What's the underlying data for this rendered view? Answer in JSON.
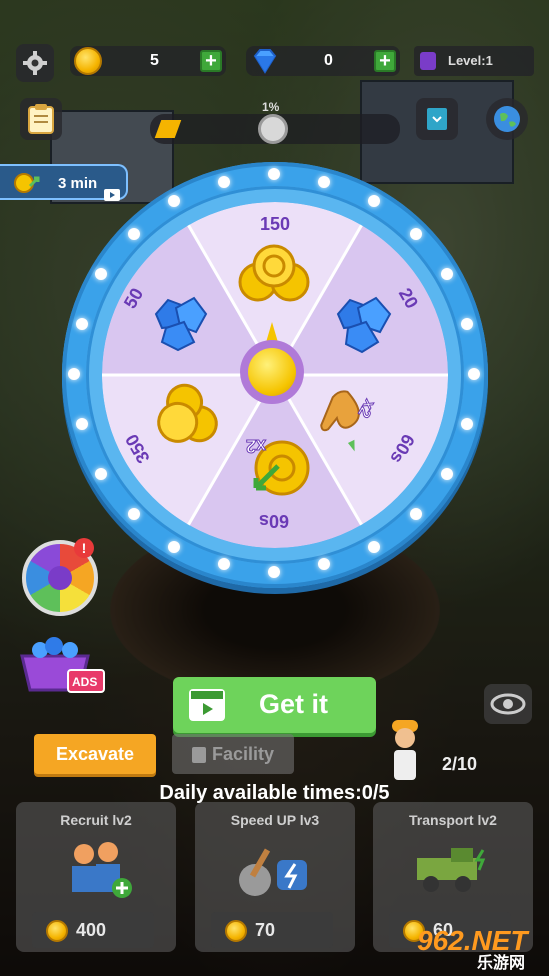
{
  "hud": {
    "coins": "5",
    "gems": "0",
    "level": "Level:1",
    "progress": "1%",
    "timer_label": "3 min"
  },
  "wheel": {
    "segments": [
      {
        "label": "150",
        "reward": "coins"
      },
      {
        "label": "20",
        "reward": "gems"
      },
      {
        "label": "60s",
        "reward": "speed-x2"
      },
      {
        "label": "60s",
        "reward": "coin-x2"
      },
      {
        "label": "350",
        "reward": "coins"
      },
      {
        "label": "50",
        "reward": "gems"
      }
    ],
    "speed_multiplier": "x2",
    "coin_multiplier": "x2"
  },
  "get_button": {
    "label": "Get it"
  },
  "tabs": {
    "excavate": "Excavate",
    "facility": "Facility"
  },
  "worker_count": "2/10",
  "daily_text": "Daily available times:0/5",
  "cards": [
    {
      "title": "Recruit  lv2",
      "price": "400"
    },
    {
      "title": "Speed UP  lv3",
      "price": "70"
    },
    {
      "title": "Transport  lv2",
      "price": "60"
    }
  ],
  "watermark": {
    "top": "962.NET",
    "bottom": "乐游网"
  },
  "colors": {
    "accent_blue": "#3aa2ea",
    "button_green": "#6ed35b",
    "wheel_purple": "#6a3ab5"
  }
}
